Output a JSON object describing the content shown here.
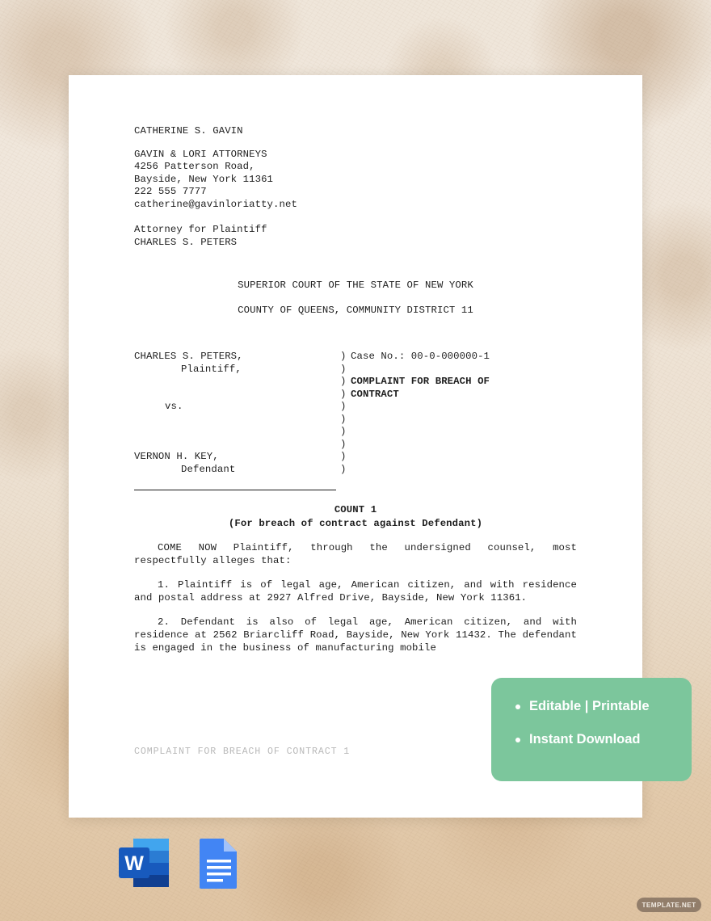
{
  "document": {
    "attorney": {
      "name": "CATHERINE S. GAVIN",
      "firm": "GAVIN & LORI ATTORNEYS",
      "street": "4256 Patterson Road,",
      "city_state_zip": "Bayside, New York 11361",
      "phone": "222 555 7777",
      "email": "catherine@gavinloriatty.net"
    },
    "representation": {
      "line1": "Attorney for Plaintiff",
      "line2": "CHARLES S. PETERS"
    },
    "court": {
      "line1": "SUPERIOR COURT OF THE STATE OF NEW YORK",
      "line2": "COUNTY OF QUEENS, COMMUNITY DISTRICT 11"
    },
    "caption": {
      "plaintiff_name": "CHARLES S. PETERS,",
      "plaintiff_role": "Plaintiff,",
      "versus": "vs.",
      "defendant_name": "VERNON H. KEY,",
      "defendant_role": "Defendant",
      "bars": ")\n)\n)\n)\n)\n)\n)\n)\n)\n)",
      "case_number_label": "Case No.: 00-0-000000-1",
      "title_line1": "COMPLAINT FOR BREACH OF",
      "title_line2": "CONTRACT"
    },
    "count": {
      "heading": "COUNT 1",
      "subheading": "(For breach of contract against Defendant)"
    },
    "body": {
      "intro": "COME NOW Plaintiff, through the undersigned counsel, most respectfully alleges that:",
      "paragraph_1": "1. Plaintiff is of legal age, American citizen, and with residence and postal address at 2927 Alfred Drive, Bayside, New York 11361.",
      "paragraph_2": "2. Defendant is also of legal age, American citizen, and with residence at 2562 Briarcliff Road, Bayside, New York 11432. The defendant is engaged in the business of manufacturing mobile"
    },
    "footer": "COMPLAINT FOR BREACH OF CONTRACT 1"
  },
  "promo": {
    "background_color": "#7cc69c",
    "items": [
      {
        "label": "Editable | Printable"
      },
      {
        "label": "Instant Download"
      }
    ]
  },
  "formats": [
    {
      "name": "microsoft-word",
      "label": "W",
      "color": "#2b5797"
    },
    {
      "name": "google-docs",
      "label": "",
      "color": "#4285f4"
    }
  ],
  "watermark": {
    "label": "TEMPLATE.NET"
  }
}
